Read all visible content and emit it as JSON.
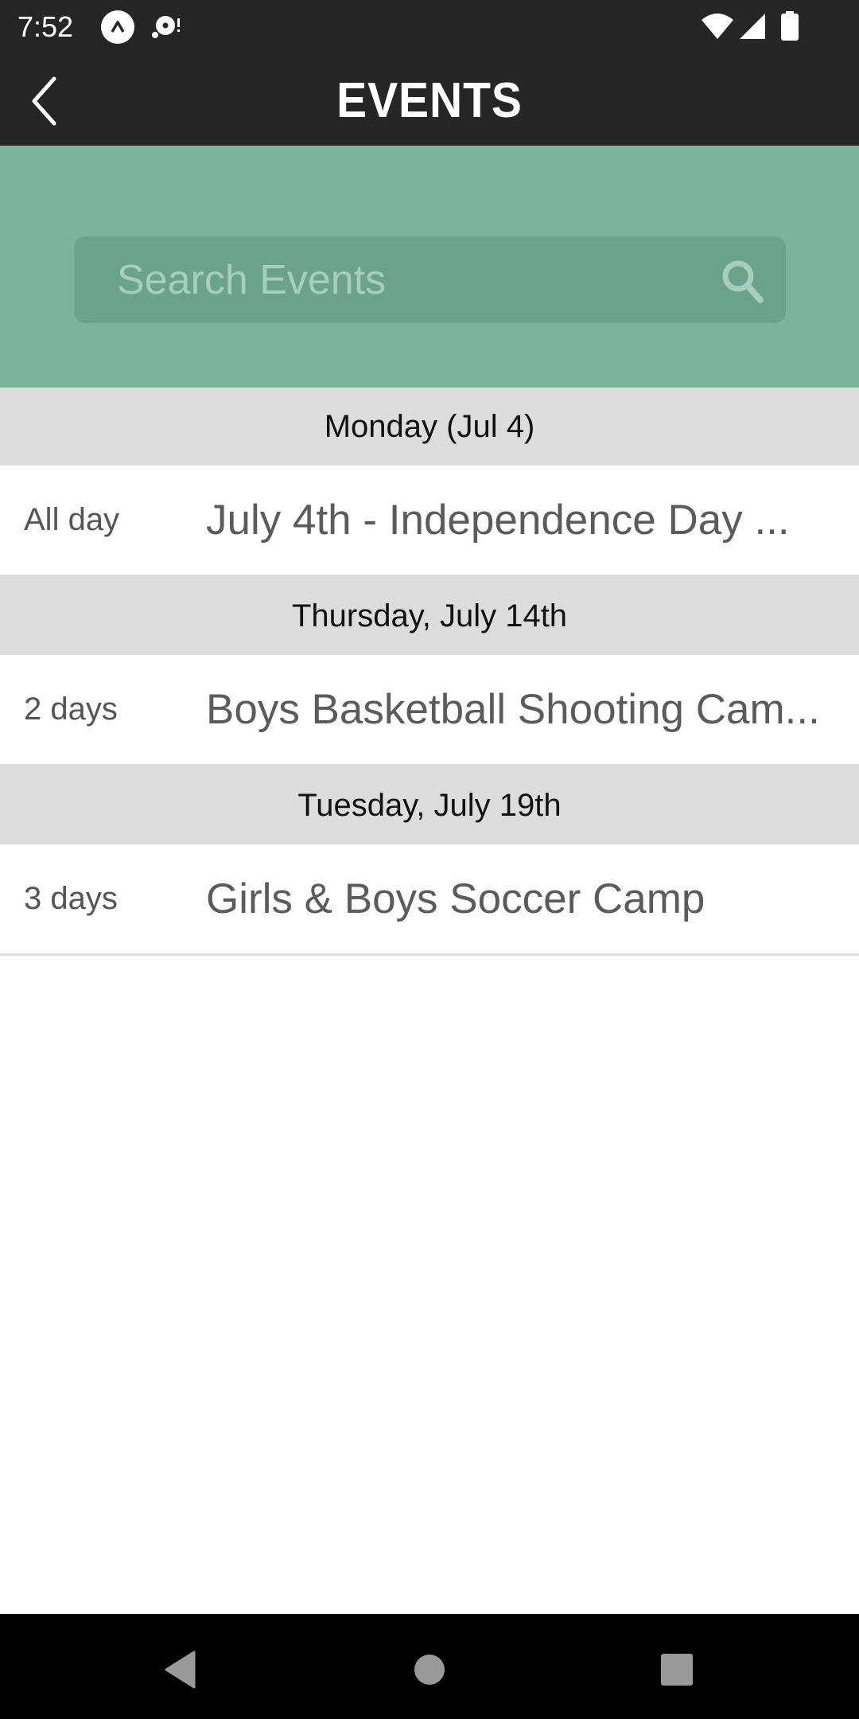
{
  "status_bar": {
    "time": "7:52",
    "icons": [
      "app-notification-icon",
      "media-notification-icon",
      "wifi-icon",
      "cell-signal-icon",
      "battery-icon"
    ]
  },
  "header": {
    "title": "EVENTS",
    "back_icon": "chevron-left-icon"
  },
  "search": {
    "placeholder": "Search Events",
    "value": "",
    "icon": "search-icon"
  },
  "colors": {
    "status_bar_bg": "#262626",
    "header_bg": "#262626",
    "accent_green": "#7bb39f",
    "search_box_bg": "#6ba28e",
    "search_placeholder": "#a6cdbf",
    "section_header_bg": "#dcdcdc",
    "nav_bar_bg": "#000000"
  },
  "sections": [
    {
      "date_label": "Monday (Jul 4)",
      "events": [
        {
          "duration": "All day",
          "title": "July 4th - Independence Day ..."
        }
      ]
    },
    {
      "date_label": "Thursday, July 14th",
      "events": [
        {
          "duration": "2 days",
          "title": "Boys Basketball Shooting Cam..."
        }
      ]
    },
    {
      "date_label": "Tuesday, July 19th",
      "events": [
        {
          "duration": "3 days",
          "title": "Girls & Boys Soccer Camp"
        }
      ]
    }
  ],
  "nav_bar": {
    "buttons": [
      "back",
      "home",
      "recents"
    ]
  }
}
